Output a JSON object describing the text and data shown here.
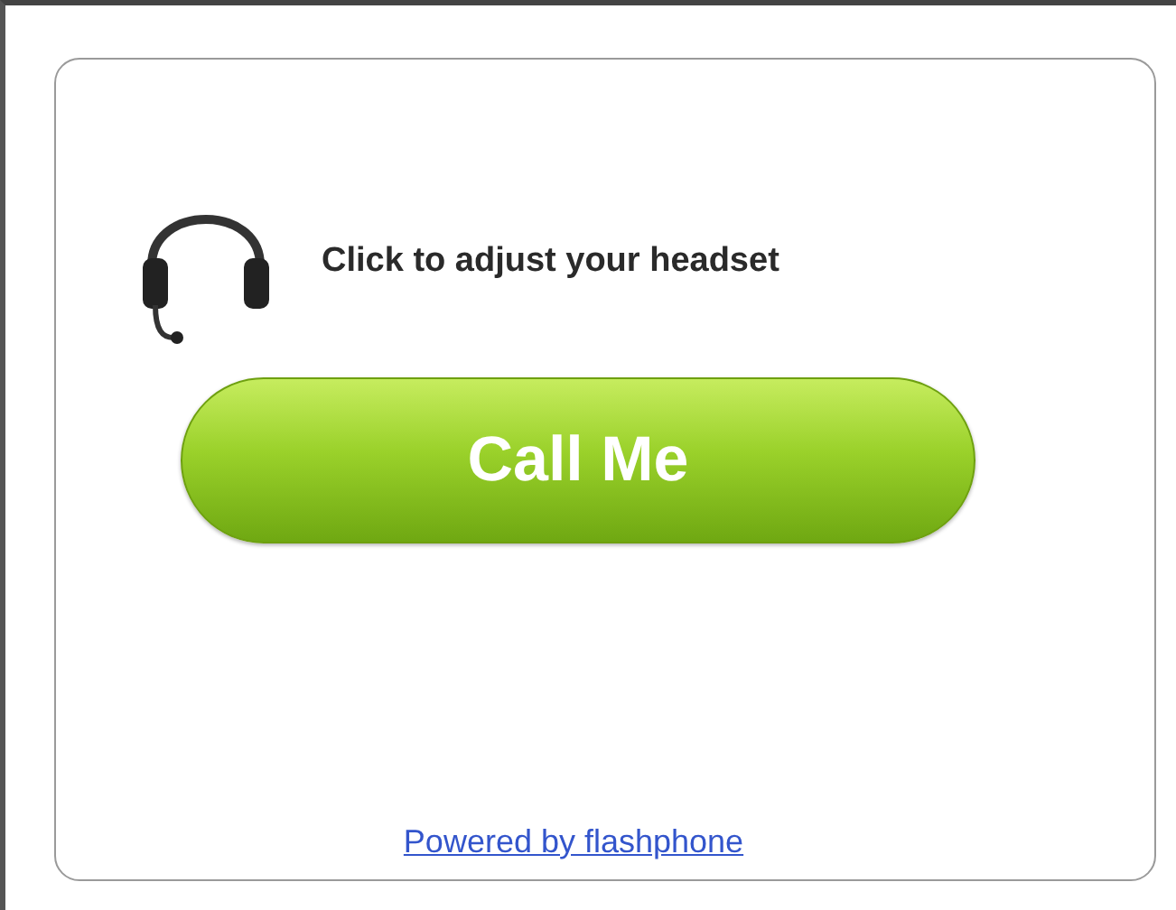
{
  "headset": {
    "label": "Click to adjust your headset"
  },
  "call_button": {
    "label": "Call Me"
  },
  "footer": {
    "link": "Powered by flashphone"
  }
}
